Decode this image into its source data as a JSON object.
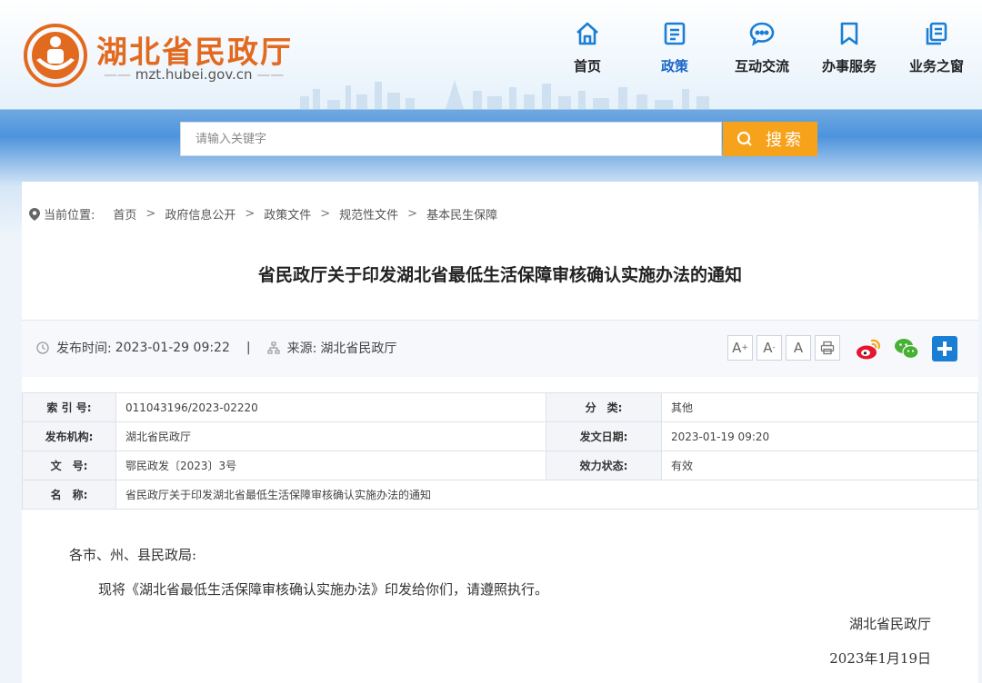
{
  "header": {
    "site_title": "湖北省民政厅",
    "site_domain": "mzt.hubei.gov.cn"
  },
  "nav": [
    {
      "label": "首页",
      "icon": "home-icon",
      "active": false
    },
    {
      "label": "政策",
      "icon": "document-list-icon",
      "active": true
    },
    {
      "label": "互动交流",
      "icon": "chat-bubble-icon",
      "active": false
    },
    {
      "label": "办事服务",
      "icon": "bookmark-icon",
      "active": false
    },
    {
      "label": "业务之窗",
      "icon": "copy-icon",
      "active": false
    }
  ],
  "search": {
    "placeholder": "请输入关键字",
    "button_label": "搜索"
  },
  "breadcrumb": {
    "label": "当前位置:",
    "items": [
      "首页",
      "政府信息公开",
      "政策文件",
      "规范性文件",
      "基本民生保障"
    ]
  },
  "article": {
    "title": "省民政厅关于印发湖北省最低生活保障审核确认实施办法的通知",
    "publish_label": "发布时间:",
    "publish_time": "2023-01-29 09:22",
    "divider": "|",
    "source_label": "来源:",
    "source": "湖北省民政厅"
  },
  "font_controls": [
    "A",
    "A",
    "A"
  ],
  "info_table": {
    "index_label": "索 引 号:",
    "index_value": "011043196/2023-02220",
    "category_label": "分　类:",
    "category_value": "其他",
    "org_label": "发布机构:",
    "org_value": "湖北省民政厅",
    "date_label": "发文日期:",
    "date_value": "2023-01-19 09:20",
    "docno_label": "文　号:",
    "docno_value": "鄂民政发〔2023〕3号",
    "status_label": "效力状态:",
    "status_value": "有效",
    "name_label": "名　称:",
    "name_value": "省民政厅关于印发湖北省最低生活保障审核确认实施办法的通知"
  },
  "body": {
    "salutation": "各市、州、县民政局:",
    "paragraph": "现将《湖北省最低生活保障审核确认实施办法》印发给你们，请遵照执行。",
    "signature": "湖北省民政厅",
    "date": "2023年1月19日"
  },
  "colors": {
    "brand_orange": "#e26a1f",
    "nav_active": "#1a66c8",
    "search_button": "#f7a21b",
    "weibo": "#e6162d",
    "wechat": "#46b134",
    "share_plus": "#1a7fd4"
  }
}
